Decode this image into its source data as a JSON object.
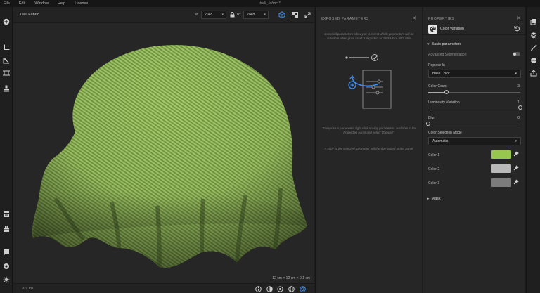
{
  "menu": [
    "File",
    "Edit",
    "Window",
    "Help",
    "License"
  ],
  "document_title": "twill_fabric *",
  "viewport": {
    "title": "Twill Fabric",
    "width_label": "w:",
    "width_value": "2048",
    "height_label": "h:",
    "height_value": "2048",
    "fps": "979 ms",
    "scale": "12 cm × 12 cm × 0.1 cm"
  },
  "exposed": {
    "title": "EXPOSED PARAMETERS",
    "description": "Exposed parameters allow you to select which parameters will be available when your asset is exported as SBSAR or SBS files.",
    "hint1": "To expose a parameter, right click on any parameters available in the Properties panel and select \"Expose\".",
    "hint2": "A copy of the selected parameter will then be added to this panel."
  },
  "properties": {
    "title": "PROPERTIES",
    "node_name": "Color Variation",
    "basic_section": "Basic parameters",
    "advanced_segmentation": "Advanced Segmentation",
    "replace_in_label": "Replace In",
    "replace_in_value": "Base Color",
    "color_count_label": "Color Count",
    "color_count_value": "3",
    "color_count_fraction": 0.2,
    "luminosity_label": "Luminosity Variation",
    "luminosity_value": "1",
    "luminosity_fraction": 1.0,
    "blur_label": "Blur",
    "blur_value": "0",
    "blur_fraction": 0.0,
    "mode_label": "Color Selection Mode",
    "mode_value": "Automatic",
    "color1_label": "Color 1",
    "color1": "#97c74e",
    "color2_label": "Color 2",
    "color2": "#b9b9b9",
    "color3_label": "Color 3",
    "color3": "#7c7c7c",
    "mask_section": "Mask"
  },
  "colors": {
    "accent": "#3f8ff0",
    "fabric": "#8fb556"
  }
}
